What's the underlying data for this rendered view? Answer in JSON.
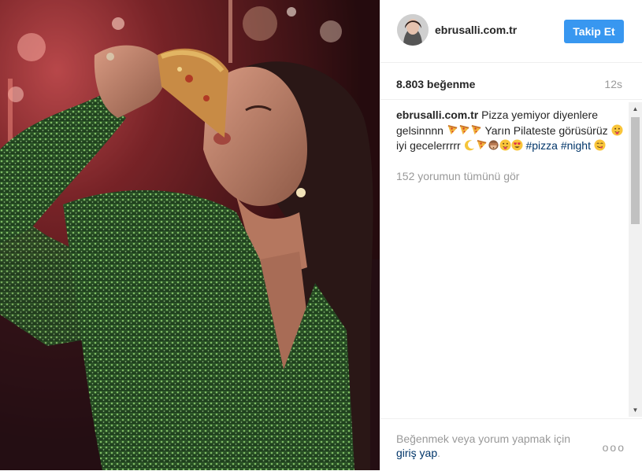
{
  "post": {
    "username": "ebrusalli.com.tr",
    "follow_label": "Takip Et",
    "likes": "8.803 beğenme",
    "time": "12s",
    "caption": {
      "author": "ebrusalli.com.tr",
      "text1": " Pizza yemiyor diyenlere gelsinnnn ",
      "text2": " Yarın Pilateste görüsürüz ",
      "text3": " iyi gecelerrrrr ",
      "hashtag1": "#pizza",
      "hashtag2": "#night"
    },
    "view_comments": "152 yorumun tümünü gör",
    "footer": {
      "prompt": "Beğenmek veya yorum yapmak için ",
      "login_link": "giriş yap",
      "after": ".",
      "more": "ooo"
    }
  },
  "colors": {
    "accent": "#3897f0",
    "link": "#003569",
    "muted": "#999999"
  },
  "icons": [
    "pizza-icon",
    "tongue-out-face-icon",
    "crescent-moon-icon",
    "see-no-evil-monkey-icon",
    "heart-eyes-face-icon",
    "yum-face-icon"
  ]
}
